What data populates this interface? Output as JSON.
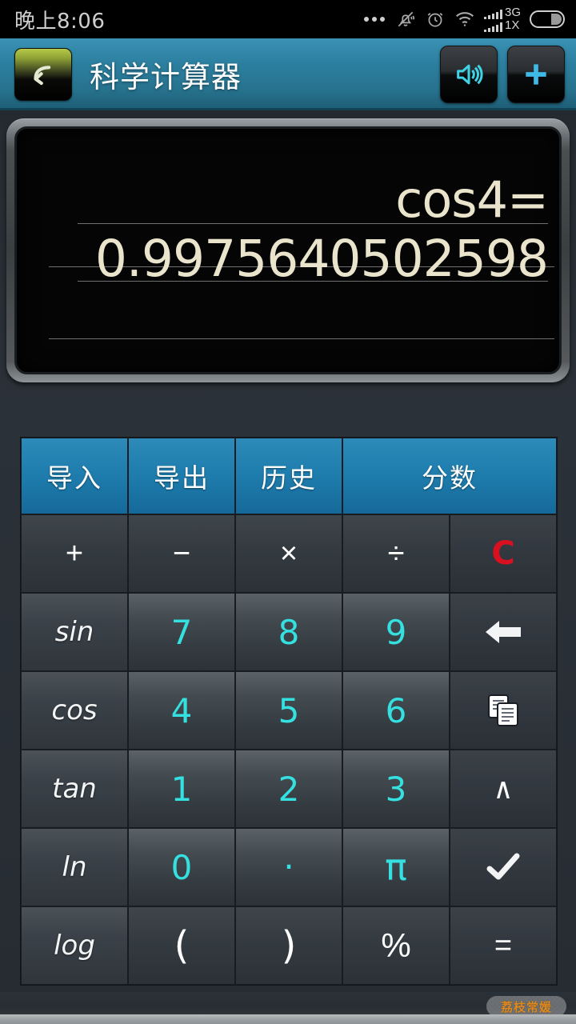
{
  "status_bar": {
    "time": "晚上8:06",
    "icons": [
      "overflow-dots",
      "bell-muted-icon",
      "alarm-clock-icon",
      "wifi-icon",
      "signal-bars-icon",
      "battery-icon"
    ],
    "network_primary": "3G",
    "network_secondary": "1X"
  },
  "app_bar": {
    "back_label": "back-arrow-icon",
    "title": "科学计算器",
    "actions": [
      {
        "name": "sound-button",
        "icon": "speaker-icon"
      },
      {
        "name": "add-button",
        "icon": "plus-icon"
      }
    ]
  },
  "display": {
    "expression": "cos4=",
    "result": "0.9975640502598",
    "text_color": "#e9e4cb",
    "background_color": "#050505"
  },
  "colors": {
    "accent_blue": "#1f7eae",
    "digit_cyan": "#35e0e0",
    "clear_red": "#d81020",
    "appbar_teal": "#2c7f9f"
  },
  "keypad": {
    "action_row": [
      {
        "label": "导入",
        "name": "import-button",
        "span": 1
      },
      {
        "label": "导出",
        "name": "export-button",
        "span": 1
      },
      {
        "label": "历史",
        "name": "history-button",
        "span": 1
      },
      {
        "label": "分数",
        "name": "fraction-button",
        "span": 2
      }
    ],
    "rows": [
      [
        {
          "label": "+",
          "name": "key-plus",
          "kind": "op"
        },
        {
          "label": "−",
          "name": "key-minus",
          "kind": "op"
        },
        {
          "label": "×",
          "name": "key-multiply",
          "kind": "op"
        },
        {
          "label": "÷",
          "name": "key-divide",
          "kind": "op"
        },
        {
          "label": "C",
          "name": "key-clear",
          "kind": "clear"
        }
      ],
      [
        {
          "label": "sin",
          "name": "key-sin",
          "kind": "fn"
        },
        {
          "label": "7",
          "name": "key-7",
          "kind": "num"
        },
        {
          "label": "8",
          "name": "key-8",
          "kind": "num"
        },
        {
          "label": "9",
          "name": "key-9",
          "kind": "num"
        },
        {
          "label": "",
          "name": "key-backspace",
          "kind": "icon",
          "icon": "backspace-arrow-icon"
        }
      ],
      [
        {
          "label": "cos",
          "name": "key-cos",
          "kind": "fn"
        },
        {
          "label": "4",
          "name": "key-4",
          "kind": "num"
        },
        {
          "label": "5",
          "name": "key-5",
          "kind": "num"
        },
        {
          "label": "6",
          "name": "key-6",
          "kind": "num"
        },
        {
          "label": "",
          "name": "key-copy",
          "kind": "icon",
          "icon": "copy-icon"
        }
      ],
      [
        {
          "label": "tan",
          "name": "key-tan",
          "kind": "fn"
        },
        {
          "label": "1",
          "name": "key-1",
          "kind": "num"
        },
        {
          "label": "2",
          "name": "key-2",
          "kind": "num"
        },
        {
          "label": "3",
          "name": "key-3",
          "kind": "num"
        },
        {
          "label": "∧",
          "name": "key-power",
          "kind": "caret"
        }
      ],
      [
        {
          "label": "ln",
          "name": "key-ln",
          "kind": "fn"
        },
        {
          "label": "0",
          "name": "key-0",
          "kind": "num"
        },
        {
          "label": "·",
          "name": "key-decimal",
          "kind": "dot"
        },
        {
          "label": "π",
          "name": "key-pi",
          "kind": "pi"
        },
        {
          "label": "",
          "name": "key-confirm",
          "kind": "icon",
          "icon": "checkmark-icon"
        }
      ],
      [
        {
          "label": "log",
          "name": "key-log",
          "kind": "fn"
        },
        {
          "label": "(",
          "name": "key-paren-open",
          "kind": "paren"
        },
        {
          "label": ")",
          "name": "key-paren-close",
          "kind": "paren"
        },
        {
          "label": "%",
          "name": "key-percent",
          "kind": "pct"
        },
        {
          "label": "=",
          "name": "key-equals",
          "kind": "op"
        }
      ]
    ]
  },
  "watermark": {
    "text": "荔枝常媛"
  }
}
